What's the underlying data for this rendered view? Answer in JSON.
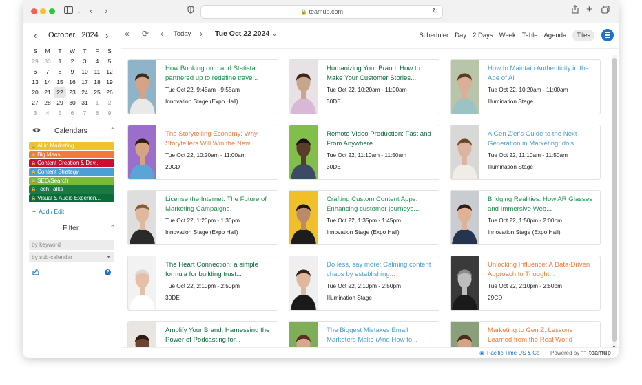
{
  "browser": {
    "url": "teamup.com",
    "colors": {
      "close": "#ff5f57",
      "minimize": "#febc2e",
      "zoom": "#28c840"
    }
  },
  "sidebar": {
    "month": "October",
    "year": "2024",
    "weekdays": [
      "S",
      "M",
      "T",
      "W",
      "T",
      "F",
      "S"
    ],
    "weeks": [
      [
        "29",
        "30",
        "1",
        "2",
        "3",
        "4",
        "5"
      ],
      [
        "6",
        "7",
        "8",
        "9",
        "10",
        "11",
        "12"
      ],
      [
        "13",
        "14",
        "15",
        "16",
        "17",
        "18",
        "19"
      ],
      [
        "20",
        "21",
        "22",
        "23",
        "24",
        "25",
        "26"
      ],
      [
        "27",
        "28",
        "29",
        "30",
        "31",
        "1",
        "2"
      ],
      [
        "3",
        "4",
        "5",
        "6",
        "7",
        "8",
        "9"
      ]
    ],
    "calendars_label": "Calendars",
    "calendars": [
      {
        "name": "AI in Marketing",
        "color": "#f2c12e"
      },
      {
        "name": "Big Ideas",
        "color": "#f07c3a"
      },
      {
        "name": "Content Creation & Dev...",
        "color": "#c8102e"
      },
      {
        "name": "Content Strategy",
        "color": "#4b9fd5"
      },
      {
        "name": "SEO/Search",
        "color": "#7aba3a"
      },
      {
        "name": "Tech Talks",
        "color": "#1a7a43"
      },
      {
        "name": "Visual & Audio Experien...",
        "color": "#0b6b3a"
      }
    ],
    "add_edit": "Add / Edit",
    "filter_label": "Filter",
    "filter_keyword_placeholder": "by keyword",
    "filter_subcalendar_placeholder": "by sub-calendar"
  },
  "toolbar": {
    "today": "Today",
    "date": "Tue Oct 22 2024",
    "views": [
      "Scheduler",
      "Day",
      "2 Days",
      "Week",
      "Table",
      "Agenda",
      "Tiles"
    ],
    "active_view": "Tiles"
  },
  "events": [
    {
      "title": "How Booking.com and Statista partnered up to redefine trave...",
      "time": "Tue Oct 22, 9:45am - 9:55am",
      "location": "Innovation Stage (Expo Hall)",
      "color": "#1a8f4c",
      "bg": "#8fb3c9",
      "skin": "#d6a384",
      "hair": "#3a2a20",
      "shirt": "#e9e9e9"
    },
    {
      "title": "Humanizing Your Brand: How to Make Your Customer Stories...",
      "time": "Tue Oct 22, 10:20am - 11:00am",
      "location": "30DE",
      "color": "#0b6b3a",
      "bg": "#e8e2e6",
      "skin": "#caa58d",
      "hair": "#3b2418",
      "shirt": "#d8b8d4"
    },
    {
      "title": "How to Maintain Authenticity in the Age of AI",
      "time": "Tue Oct 22, 10:20am - 11:00am",
      "location": "Illumination Stage",
      "color": "#4b9fd5",
      "bg": "#b8c5a9",
      "skin": "#d9b096",
      "hair": "#5a3a26",
      "shirt": "#9bc3c4"
    },
    {
      "title": "The Storytelling Economy: Why Storytellers Will Win the New...",
      "time": "Tue Oct 22, 10:20am - 11:00am",
      "location": "29CD",
      "color": "#f07c3a",
      "bg": "#9b6fc9",
      "skin": "#d6a384",
      "hair": "#2a1d16",
      "shirt": "#5aa5d8"
    },
    {
      "title": "Remote Video Production: Fast and From Anywhere",
      "time": "Tue Oct 22, 11:10am - 11:50am",
      "location": "30DE",
      "color": "#0b6b3a",
      "bg": "#7fbf4a",
      "skin": "#5b3b2a",
      "hair": "#1a1210",
      "shirt": "#3c4a66"
    },
    {
      "title": "A Gen Z'er's Guide to the Next Generation in Marketing: do's...",
      "time": "Tue Oct 22, 11:10am - 11:50am",
      "location": "Illumination Stage",
      "color": "#4b9fd5",
      "bg": "#d8d8d6",
      "skin": "#dcb4a0",
      "hair": "#6a4528",
      "shirt": "#f0ece6"
    },
    {
      "title": "License the Internet: The Future of Marketing Campaigns",
      "time": "Tue Oct 22, 1:20pm - 1:30pm",
      "location": "Innovation Stage (Expo Hall)",
      "color": "#1a8f4c",
      "bg": "#dedede",
      "skin": "#e0b89e",
      "hair": "#8a5a30",
      "shirt": "#2a2a2a"
    },
    {
      "title": "Crafting Custom Content Apps: Enhancing customer journeys...",
      "time": "Tue Oct 22, 1:35pm - 1:45pm",
      "location": "Innovation Stage (Expo Hall)",
      "color": "#1a8f4c",
      "bg": "#f0c02a",
      "skin": "#b98a6c",
      "hair": "#1a1210",
      "shirt": "#1d1d1d"
    },
    {
      "title": "Bridging Realities: How AR Glasses and Immersive Web...",
      "time": "Tue Oct 22, 1:50pm - 2:00pm",
      "location": "Innovation Stage (Expo Hall)",
      "color": "#1a8f4c",
      "bg": "#c9cdd2",
      "skin": "#e0b295",
      "hair": "#2e1e16",
      "shirt": "#26354e"
    },
    {
      "title": "The Heart Connection: a simple formula for building trust...",
      "time": "Tue Oct 22, 2:10pm - 2:50pm",
      "location": "30DE",
      "color": "#0b6b3a",
      "bg": "#f2f2f2",
      "skin": "#e6bfa6",
      "hair": "#d9d9d9",
      "shirt": "#ffffff"
    },
    {
      "title": "Do less, say more: Calming content chaos by establishing...",
      "time": "Tue Oct 22, 2:10pm - 2:50pm",
      "location": "Illumination Stage",
      "color": "#4b9fd5",
      "bg": "#efefef",
      "skin": "#e0b89e",
      "hair": "#3a2418",
      "shirt": "#1a1a1a"
    },
    {
      "title": "Unlocking Influence: A Data-Driven Approach to Thought...",
      "time": "Tue Oct 22, 2:10pm - 2:50pm",
      "location": "29CD",
      "color": "#f07c3a",
      "bg": "#3a3a3a",
      "skin": "#bdbdbd",
      "hair": "#8a8a8a",
      "shirt": "#1a1a1a"
    },
    {
      "title": "Amplify Your Brand: Harnessing the Power of Podcasting for...",
      "time": "",
      "location": "",
      "color": "#0b6b3a",
      "bg": "#e9e6e2",
      "skin": "#6b4430",
      "hair": "#2a1a12",
      "shirt": "#5a5a5a"
    },
    {
      "title": "The Biggest Mistakes Email Marketers Make (And How to...",
      "time": "",
      "location": "",
      "color": "#4b9fd5",
      "bg": "#7fae58",
      "skin": "#d9a88c",
      "hair": "#5a2f1e",
      "shirt": "#8a3a3a"
    },
    {
      "title": "Marketing to Gen Z: Lessons Learned from the Real World",
      "time": "",
      "location": "",
      "color": "#f07c3a",
      "bg": "#8aa07a",
      "skin": "#d3a385",
      "hair": "#4a2c1c",
      "shirt": "#6a6a6a"
    }
  ],
  "footer": {
    "timezone": "Pacific Time US & Ca",
    "powered_by": "Powered by",
    "brand": "teamup"
  }
}
